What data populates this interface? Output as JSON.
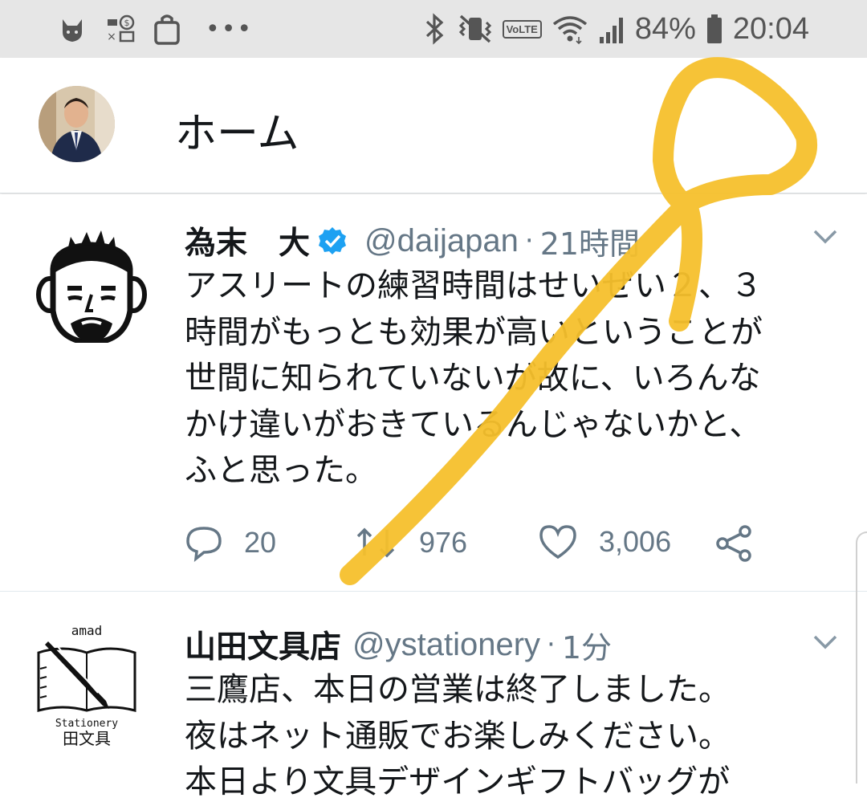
{
  "status_bar": {
    "battery": "84%",
    "time": "20:04",
    "network_badge": "VoLTE",
    "colors": {
      "background": "#e6e6e6",
      "icons": "#555555"
    },
    "icons": [
      "fox-notification-icon",
      "payment-notification-icon",
      "shopping-bag-icon",
      "more-dots-icon",
      "bluetooth-icon",
      "vibrate-mute-icon",
      "volte-icon",
      "wifi-icon",
      "signal-icon",
      "battery-icon"
    ]
  },
  "header": {
    "title": "ホーム"
  },
  "tweets": [
    {
      "name": "為末　大",
      "verified": true,
      "handle": "@daijapan",
      "time": "21時間",
      "text": "アスリートの練習時間はせいぜい２、３\n時間がもっとも効果が高いということが\n世間に知られていないが故に、いろんな\nかけ違いがおきているんじゃないかと、\nふと思った。",
      "replies": "20",
      "retweets": "976",
      "likes": "3,006"
    },
    {
      "name": "山田文具店",
      "handle": "@ystationery",
      "time": "1分",
      "text": "三鷹店、本日の営業は終了しました。\n夜はネット通販でお楽しみください。\n本日より文具デザインギフトバッグが",
      "avatar_logo_text": [
        "amad",
        "Stationery",
        "田文具"
      ]
    }
  ],
  "colors": {
    "text": "#14171a",
    "secondary": "#657786",
    "verified": "#1da1f2",
    "annotation": "#f5c02c"
  }
}
